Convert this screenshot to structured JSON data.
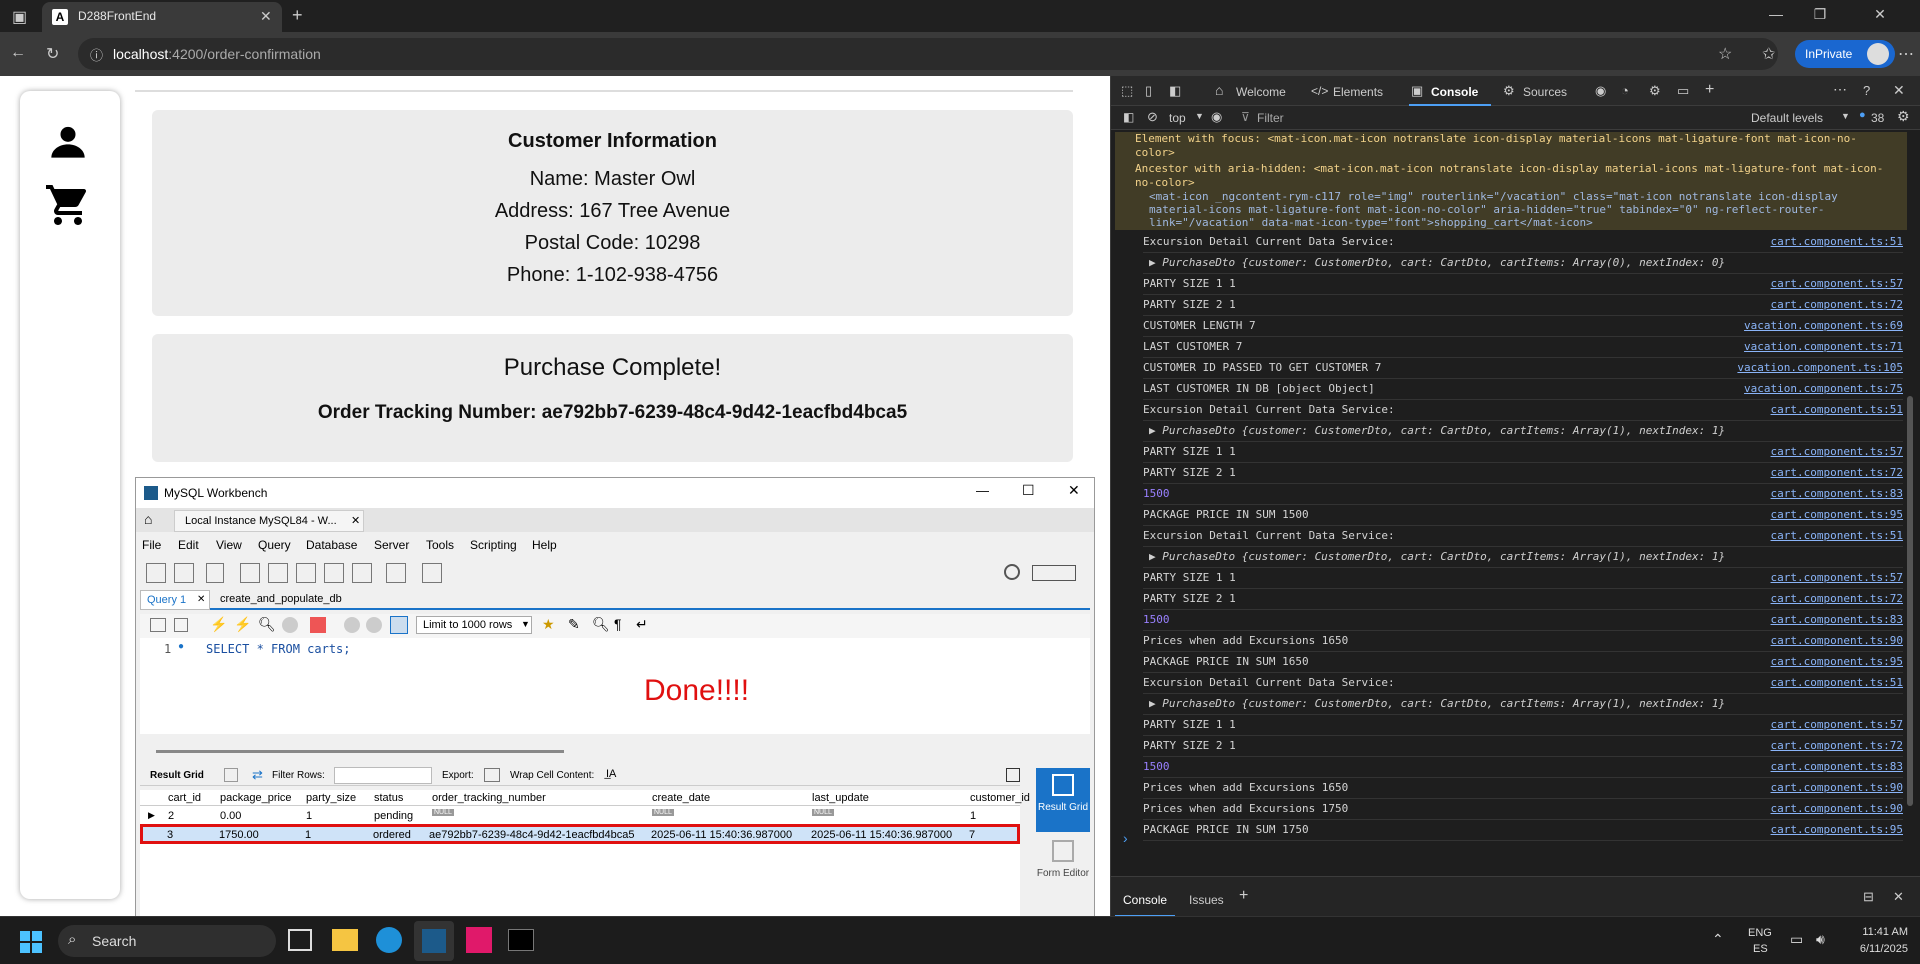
{
  "browser": {
    "tab_title": "D288FrontEnd",
    "tab_favicon": "A",
    "url_host": "localhost",
    "url_path": ":4200/order-confirmation",
    "inprivate_label": "InPrivate"
  },
  "customer": {
    "heading": "Customer Information",
    "name": "Name: Master Owl",
    "address": "Address: 167 Tree Avenue",
    "postal": "Postal Code: 10298",
    "phone": "Phone: 1-102-938-4756"
  },
  "purchase": {
    "heading": "Purchase Complete!",
    "tracking": "Order Tracking Number: ae792bb7-6239-48c4-9d42-1eacfbd4bca5"
  },
  "workbench": {
    "title": "MySQL Workbench",
    "instance_tab": "Local Instance MySQL84 - W...",
    "menu": [
      "File",
      "Edit",
      "View",
      "Query",
      "Database",
      "Server",
      "Tools",
      "Scripting",
      "Help"
    ],
    "query_tab": "Query 1",
    "script_tab": "create_and_populate_db",
    "limit": "Limit to 1000 rows",
    "line_no": "1",
    "sql": "SELECT * FROM carts;",
    "done": "Done!!!!",
    "result_grid_label": "Result Grid",
    "filter_label": "Filter Rows:",
    "export_label": "Export:",
    "wrap_label": "Wrap Cell Content:",
    "side_result": "Result Grid",
    "side_form": "Form Editor",
    "columns": [
      "cart_id",
      "package_price",
      "party_size",
      "status",
      "order_tracking_number",
      "create_date",
      "last_update",
      "customer_id"
    ],
    "row1": [
      "2",
      "0.00",
      "1",
      "pending",
      "NULL",
      "NULL",
      "NULL",
      "1"
    ],
    "row2": [
      "3",
      "1750.00",
      "1",
      "ordered",
      "ae792bb7-6239-48c4-9d42-1eacfbd4bca5",
      "2025-06-11 15:40:36.987000",
      "2025-06-11 15:40:36.987000",
      "7"
    ]
  },
  "devtools": {
    "tabs": [
      "Welcome",
      "Elements",
      "Console",
      "Sources"
    ],
    "context": "top",
    "filter_placeholder": "Filter",
    "levels": "Default levels",
    "issues_count": "38",
    "warn_1": "Element with focus: <mat-icon.mat-icon notranslate icon-display material-icons mat-ligature-font mat-icon-no-color>",
    "warn_2": "Ancestor with aria-hidden: <mat-icon.mat-icon notranslate icon-display material-icons mat-ligature-font mat-icon-no-color>",
    "warn_3": "<mat-icon _ngcontent-rym-c117 role=\"img\" routerlink=\"/vacation\" class=\"mat-icon notranslate icon-display material-icons mat-ligature-font mat-icon-no-color\" aria-hidden=\"true\" tabindex=\"0\" ng-reflect-router-link=\"/vacation\" data-mat-icon-type=\"font\">shopping_cart</mat-icon>",
    "logs": [
      {
        "t": "Excursion Detail Current Data Service:",
        "l": "cart.component.ts:51"
      },
      {
        "t": "▶ PurchaseDto {customer: CustomerDto, cart: CartDto, cartItems: Array(0), nextIndex: 0}",
        "l": ""
      },
      {
        "t": "PARTY SIZE 1 1",
        "l": "cart.component.ts:57"
      },
      {
        "t": "PARTY SIZE 2 1",
        "l": "cart.component.ts:72"
      },
      {
        "t": "CUSTOMER LENGTH 7",
        "l": "vacation.component.ts:69"
      },
      {
        "t": "LAST CUSTOMER 7",
        "l": "vacation.component.ts:71"
      },
      {
        "t": "CUSTOMER ID PASSED TO GET CUSTOMER 7",
        "l": "vacation.component.ts:105"
      },
      {
        "t": "LAST CUSTOMER IN DB [object Object]",
        "l": "vacation.component.ts:75"
      },
      {
        "t": "Excursion Detail Current Data Service:",
        "l": "cart.component.ts:51"
      },
      {
        "t": "▶ PurchaseDto {customer: CustomerDto, cart: CartDto, cartItems: Array(1), nextIndex: 1}",
        "l": ""
      },
      {
        "t": "PARTY SIZE 1 1",
        "l": "cart.component.ts:57"
      },
      {
        "t": "PARTY SIZE 2 1",
        "l": "cart.component.ts:72"
      },
      {
        "t": "1500",
        "l": "cart.component.ts:83"
      },
      {
        "t": "PACKAGE PRICE IN SUM 1500",
        "l": "cart.component.ts:95"
      },
      {
        "t": "Excursion Detail Current Data Service:",
        "l": "cart.component.ts:51"
      },
      {
        "t": "▶ PurchaseDto {customer: CustomerDto, cart: CartDto, cartItems: Array(1), nextIndex: 1}",
        "l": ""
      },
      {
        "t": "PARTY SIZE 1 1",
        "l": "cart.component.ts:57"
      },
      {
        "t": "PARTY SIZE 2 1",
        "l": "cart.component.ts:72"
      },
      {
        "t": "1500",
        "l": "cart.component.ts:83"
      },
      {
        "t": "Prices when add Excursions 1650",
        "l": "cart.component.ts:90"
      },
      {
        "t": "PACKAGE PRICE IN SUM 1650",
        "l": "cart.component.ts:95"
      },
      {
        "t": "Excursion Detail Current Data Service:",
        "l": "cart.component.ts:51"
      },
      {
        "t": "▶ PurchaseDto {customer: CustomerDto, cart: CartDto, cartItems: Array(1), nextIndex: 1}",
        "l": ""
      },
      {
        "t": "PARTY SIZE 1 1",
        "l": "cart.component.ts:57"
      },
      {
        "t": "PARTY SIZE 2 1",
        "l": "cart.component.ts:72"
      },
      {
        "t": "1500",
        "l": "cart.component.ts:83"
      },
      {
        "t": "Prices when add Excursions 1650",
        "l": "cart.component.ts:90"
      },
      {
        "t": "Prices when add Excursions 1750",
        "l": "cart.component.ts:90"
      },
      {
        "t": "PACKAGE PRICE IN SUM 1750",
        "l": "cart.component.ts:95"
      }
    ],
    "bottom_tab_console": "Console",
    "bottom_tab_issues": "Issues"
  },
  "taskbar": {
    "search": "Search",
    "lang1": "ENG",
    "lang2": "ES",
    "time": "11:41 AM",
    "date": "6/11/2025"
  }
}
